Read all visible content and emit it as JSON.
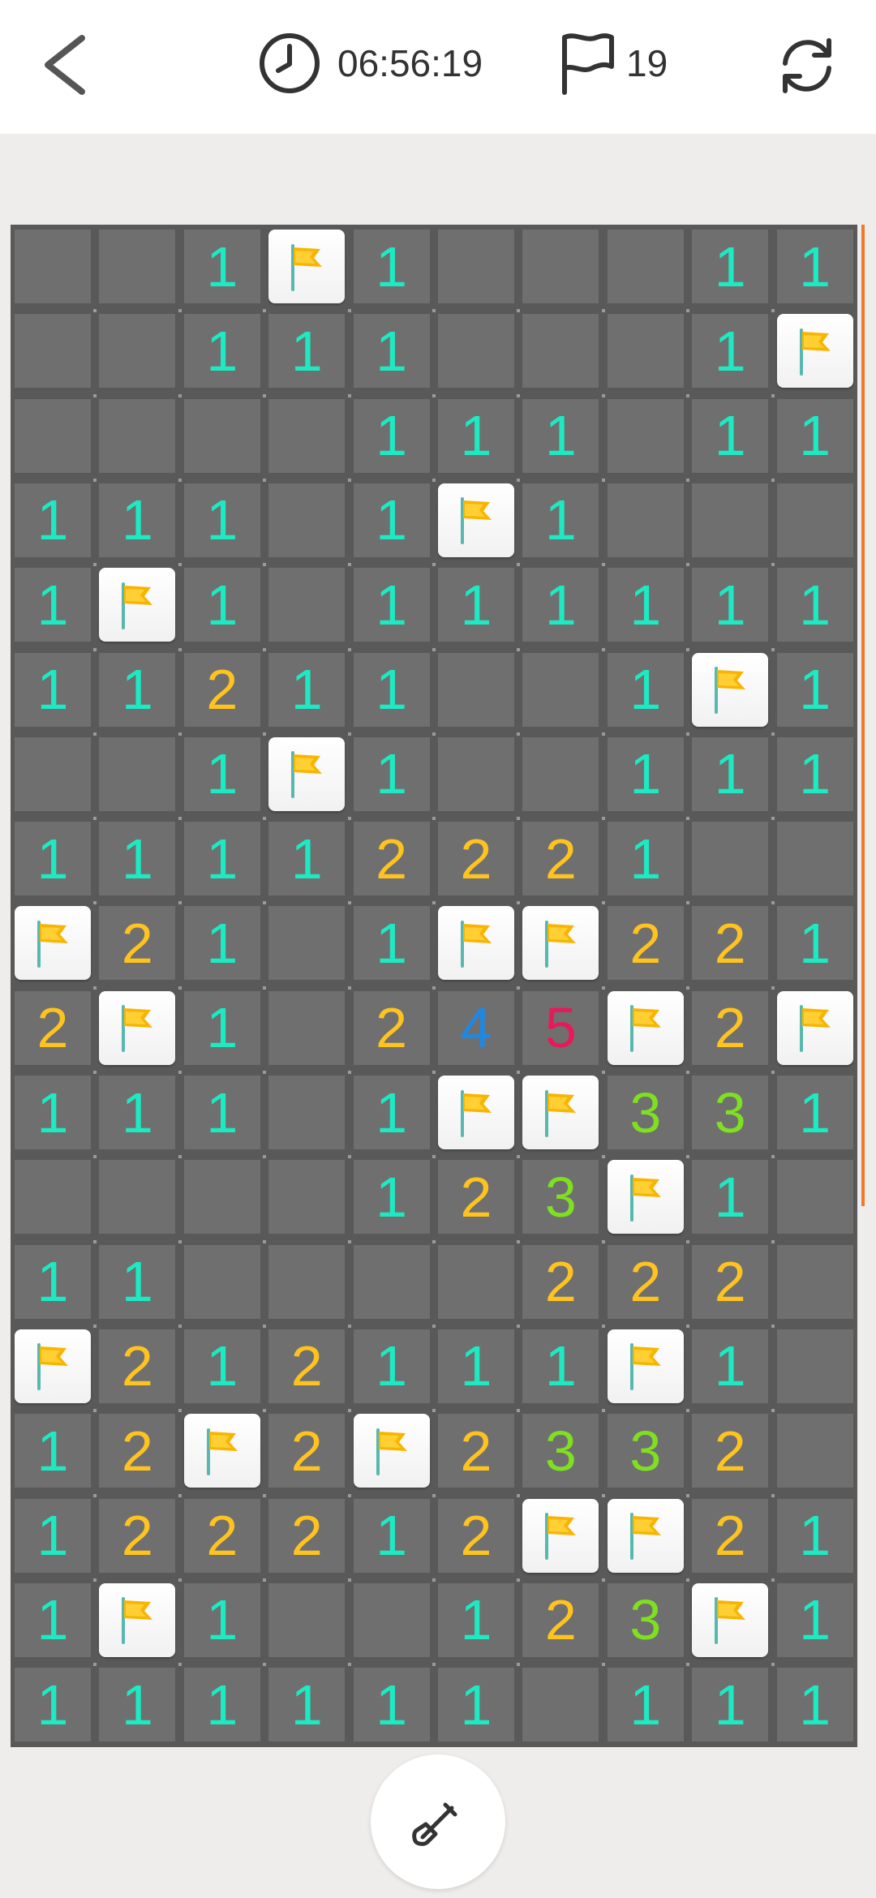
{
  "header": {
    "timer": "06:56:19",
    "flag_count": "19"
  },
  "colors": {
    "background": "#efedeb",
    "board": "#595959",
    "cell": "#6f6f6f",
    "number_1": "#1de9c2",
    "number_2": "#ffc31f",
    "number_3": "#7ee020",
    "number_4": "#1e88e5",
    "number_5": "#e8195a",
    "flag": "#f8b400",
    "accent_scroll": "#f07a2a"
  },
  "board": {
    "rows": 18,
    "cols": 10,
    "legend": "F = flag, 0 = empty revealed/covered tile, digits = adjacent mine counts",
    "grid": [
      [
        "0",
        "0",
        "1",
        "F",
        "1",
        "0",
        "0",
        "0",
        "1",
        "1"
      ],
      [
        "0",
        "0",
        "1",
        "1",
        "1",
        "0",
        "0",
        "0",
        "1",
        "F"
      ],
      [
        "0",
        "0",
        "0",
        "0",
        "1",
        "1",
        "1",
        "0",
        "1",
        "1"
      ],
      [
        "1",
        "1",
        "1",
        "0",
        "1",
        "F",
        "1",
        "0",
        "0",
        "0"
      ],
      [
        "1",
        "F",
        "1",
        "0",
        "1",
        "1",
        "1",
        "1",
        "1",
        "1"
      ],
      [
        "1",
        "1",
        "2",
        "1",
        "1",
        "0",
        "0",
        "1",
        "F",
        "1"
      ],
      [
        "0",
        "0",
        "1",
        "F",
        "1",
        "0",
        "0",
        "1",
        "1",
        "1"
      ],
      [
        "1",
        "1",
        "1",
        "1",
        "2",
        "2",
        "2",
        "1",
        "0",
        "0"
      ],
      [
        "F",
        "2",
        "1",
        "0",
        "1",
        "F",
        "F",
        "2",
        "2",
        "1"
      ],
      [
        "2",
        "F",
        "1",
        "0",
        "2",
        "4",
        "5",
        "F",
        "2",
        "F"
      ],
      [
        "1",
        "1",
        "1",
        "0",
        "1",
        "F",
        "F",
        "3",
        "3",
        "1"
      ],
      [
        "0",
        "0",
        "0",
        "0",
        "1",
        "2",
        "3",
        "F",
        "1",
        "0"
      ],
      [
        "1",
        "1",
        "0",
        "0",
        "0",
        "0",
        "2",
        "2",
        "2",
        "0"
      ],
      [
        "F",
        "2",
        "1",
        "2",
        "1",
        "1",
        "1",
        "F",
        "1",
        "0"
      ],
      [
        "1",
        "2",
        "F",
        "2",
        "F",
        "2",
        "3",
        "3",
        "2",
        "0"
      ],
      [
        "1",
        "2",
        "2",
        "2",
        "1",
        "2",
        "F",
        "F",
        "2",
        "1"
      ],
      [
        "1",
        "F",
        "1",
        "0",
        "0",
        "1",
        "2",
        "3",
        "F",
        "1"
      ],
      [
        "1",
        "1",
        "1",
        "1",
        "1",
        "1",
        "0",
        "1",
        "1",
        "1"
      ]
    ]
  },
  "icons": {
    "back": "chevron-left-icon",
    "timer": "clock-icon",
    "flags": "flag-outline-icon",
    "restart": "refresh-icon",
    "tool": "shovel-icon"
  }
}
